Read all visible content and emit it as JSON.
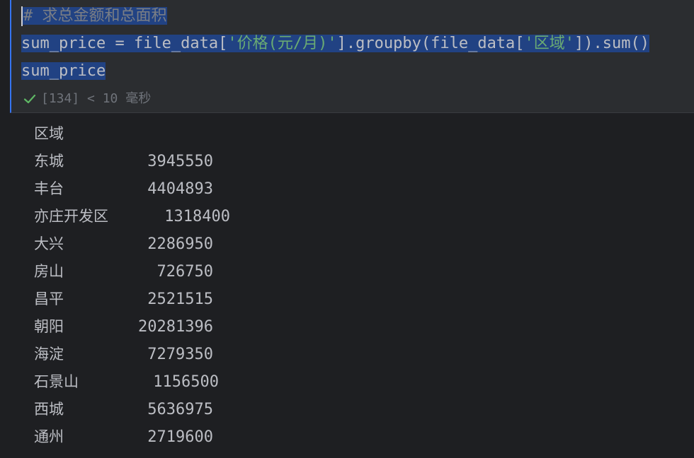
{
  "cell": {
    "code": {
      "line1_comment": "# 求总金额和总面积",
      "line2_a": "sum_price = file_data[",
      "line2_str1": "'价格(元/月)'",
      "line2_b": "].groupby(file_data[",
      "line2_str2": "'区域'",
      "line2_c": "]).sum()",
      "line3": "sum_price"
    },
    "status": {
      "exec_count": "[134]",
      "duration": "< 10 毫秒"
    }
  },
  "output": {
    "index_name": "区域",
    "rows": [
      {
        "label": "东城",
        "value": "3945550"
      },
      {
        "label": "丰台",
        "value": "4404893"
      },
      {
        "label": "亦庄开发区",
        "value": "1318400"
      },
      {
        "label": "大兴",
        "value": "2286950"
      },
      {
        "label": "房山",
        "value": "726750"
      },
      {
        "label": "昌平",
        "value": "2521515"
      },
      {
        "label": "朝阳",
        "value": "20281396"
      },
      {
        "label": "海淀",
        "value": "7279350"
      },
      {
        "label": "石景山",
        "value": "1156500"
      },
      {
        "label": "西城",
        "value": "5636975"
      },
      {
        "label": "通州",
        "value": "2719600"
      }
    ]
  },
  "colors": {
    "background": "#1e1f22",
    "cell_background": "#2b2d30",
    "selection": "#214283",
    "string": "#6aab73",
    "comment": "#7a7e85",
    "success_check": "#5fb865"
  }
}
